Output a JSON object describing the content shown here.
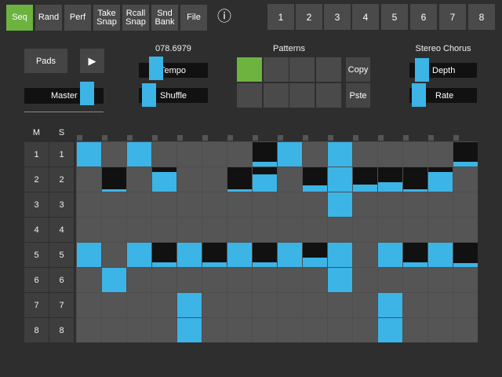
{
  "colors": {
    "accent_green": "#6db33f",
    "cell_blue": "#3cb4e6",
    "cell_grey": "#555555",
    "cell_black": "#111111"
  },
  "toolbar": {
    "modes": [
      {
        "label": "Seq",
        "active": true
      },
      {
        "label": "Rand",
        "active": false
      },
      {
        "label": "Perf",
        "active": false
      },
      {
        "label": "Take\nSnap",
        "active": false
      },
      {
        "label": "Rcall\nSnap",
        "active": false
      },
      {
        "label": "Snd\nBank",
        "active": false
      },
      {
        "label": "File",
        "active": false
      }
    ],
    "info_icon": "ⓘ",
    "banks": [
      "1",
      "2",
      "3",
      "4",
      "5",
      "6",
      "7",
      "8"
    ]
  },
  "controls": {
    "pads_label": "Pads",
    "play_icon": "▶",
    "master_label": "Master",
    "master_level": 0.85,
    "tempo_value": "078.6979",
    "tempo_label": "Tempo",
    "tempo_level": 0.18,
    "shuffle_label": "Shuffle",
    "shuffle_level": 0.05
  },
  "patterns": {
    "title": "Patterns",
    "copy_label": "Copy",
    "paste_label": "Pste",
    "active_index": 0
  },
  "effect": {
    "title": "Stereo Chorus",
    "depth_label": "Depth",
    "depth_level": 0.1,
    "rate_label": "Rate",
    "rate_level": 0.05
  },
  "sequencer": {
    "mute_header": "M",
    "solo_header": "S",
    "rows": [
      "1",
      "2",
      "3",
      "4",
      "5",
      "6",
      "7",
      "8"
    ],
    "steps": [
      [
        [
          1,
          1
        ],
        [
          0,
          0
        ],
        [
          1,
          1
        ],
        [
          0,
          0
        ],
        [
          0,
          0
        ],
        [
          0,
          0
        ],
        [
          0,
          0
        ],
        [
          2,
          0.2
        ],
        [
          1,
          1
        ],
        [
          0,
          0
        ],
        [
          1,
          1
        ],
        [
          0,
          0
        ],
        [
          0,
          0
        ],
        [
          0,
          0
        ],
        [
          0,
          0
        ],
        [
          2,
          0.2
        ]
      ],
      [
        [
          0,
          0
        ],
        [
          2,
          0.1
        ],
        [
          0,
          0
        ],
        [
          2,
          0.8
        ],
        [
          0,
          0
        ],
        [
          0,
          0
        ],
        [
          2,
          0.1
        ],
        [
          2,
          0.7
        ],
        [
          0,
          0
        ],
        [
          2,
          0.25
        ],
        [
          1,
          1
        ],
        [
          2,
          0.3
        ],
        [
          2,
          0.4
        ],
        [
          2,
          0.1
        ],
        [
          2,
          0.8
        ],
        [
          0,
          0
        ]
      ],
      [
        [
          0,
          0
        ],
        [
          0,
          0
        ],
        [
          0,
          0
        ],
        [
          0,
          0
        ],
        [
          0,
          0
        ],
        [
          0,
          0
        ],
        [
          0,
          0
        ],
        [
          0,
          0
        ],
        [
          0,
          0
        ],
        [
          0,
          0
        ],
        [
          1,
          1
        ],
        [
          0,
          0
        ],
        [
          0,
          0
        ],
        [
          0,
          0
        ],
        [
          0,
          0
        ],
        [
          0,
          0
        ]
      ],
      [
        [
          0,
          0
        ],
        [
          0,
          0
        ],
        [
          0,
          0
        ],
        [
          0,
          0
        ],
        [
          0,
          0
        ],
        [
          0,
          0
        ],
        [
          0,
          0
        ],
        [
          0,
          0
        ],
        [
          0,
          0
        ],
        [
          0,
          0
        ],
        [
          0,
          0
        ],
        [
          0,
          0
        ],
        [
          0,
          0
        ],
        [
          0,
          0
        ],
        [
          0,
          0
        ],
        [
          0,
          0
        ]
      ],
      [
        [
          1,
          1
        ],
        [
          0,
          0
        ],
        [
          1,
          1
        ],
        [
          2,
          0.2
        ],
        [
          1,
          1
        ],
        [
          2,
          0.2
        ],
        [
          1,
          1
        ],
        [
          2,
          0.2
        ],
        [
          1,
          1
        ],
        [
          2,
          0.4
        ],
        [
          1,
          1
        ],
        [
          0,
          0
        ],
        [
          1,
          1
        ],
        [
          2,
          0.2
        ],
        [
          1,
          1
        ],
        [
          2,
          0.15
        ]
      ],
      [
        [
          0,
          0
        ],
        [
          1,
          1
        ],
        [
          0,
          0
        ],
        [
          0,
          0
        ],
        [
          0,
          0
        ],
        [
          0,
          0
        ],
        [
          0,
          0
        ],
        [
          0,
          0
        ],
        [
          0,
          0
        ],
        [
          0,
          0
        ],
        [
          1,
          1
        ],
        [
          0,
          0
        ],
        [
          0,
          0
        ],
        [
          0,
          0
        ],
        [
          0,
          0
        ],
        [
          0,
          0
        ]
      ],
      [
        [
          0,
          0
        ],
        [
          0,
          0
        ],
        [
          0,
          0
        ],
        [
          0,
          0
        ],
        [
          1,
          1
        ],
        [
          0,
          0
        ],
        [
          0,
          0
        ],
        [
          0,
          0
        ],
        [
          0,
          0
        ],
        [
          0,
          0
        ],
        [
          0,
          0
        ],
        [
          0,
          0
        ],
        [
          1,
          1
        ],
        [
          0,
          0
        ],
        [
          0,
          0
        ],
        [
          0,
          0
        ]
      ],
      [
        [
          0,
          0
        ],
        [
          0,
          0
        ],
        [
          0,
          0
        ],
        [
          0,
          0
        ],
        [
          1,
          1
        ],
        [
          0,
          0
        ],
        [
          0,
          0
        ],
        [
          0,
          0
        ],
        [
          0,
          0
        ],
        [
          0,
          0
        ],
        [
          0,
          0
        ],
        [
          0,
          0
        ],
        [
          1,
          1
        ],
        [
          0,
          0
        ],
        [
          0,
          0
        ],
        [
          0,
          0
        ]
      ]
    ]
  }
}
